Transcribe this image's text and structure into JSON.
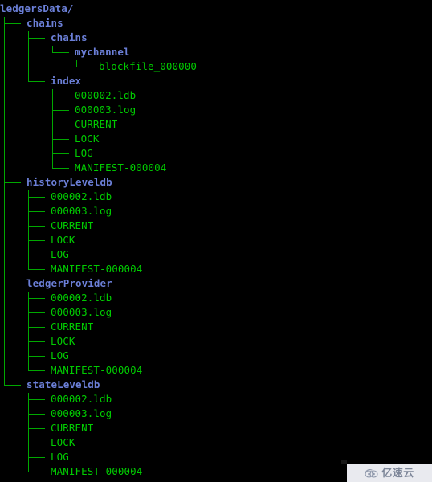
{
  "terminal": {
    "background_color": "#000000",
    "dir_color": "#6b7fd7",
    "file_color": "#00cc00",
    "line_color": "#00a800",
    "root": "ledgersData/"
  },
  "tree": {
    "rows": [
      {
        "text": "ledgersData/",
        "kind": "dir",
        "depth": 0
      },
      {
        "text": "chains",
        "kind": "dir",
        "depth": 1
      },
      {
        "text": "chains",
        "kind": "dir",
        "depth": 2
      },
      {
        "text": "mychannel",
        "kind": "dir",
        "depth": 3
      },
      {
        "text": "blockfile_000000",
        "kind": "file",
        "depth": 4
      },
      {
        "text": "index",
        "kind": "dir",
        "depth": 2
      },
      {
        "text": "000002.ldb",
        "kind": "file",
        "depth": 3
      },
      {
        "text": "000003.log",
        "kind": "file",
        "depth": 3
      },
      {
        "text": "CURRENT",
        "kind": "file",
        "depth": 3
      },
      {
        "text": "LOCK",
        "kind": "file",
        "depth": 3
      },
      {
        "text": "LOG",
        "kind": "file",
        "depth": 3
      },
      {
        "text": "MANIFEST-000004",
        "kind": "file",
        "depth": 3
      },
      {
        "text": "historyLeveldb",
        "kind": "dir",
        "depth": 1
      },
      {
        "text": "000002.ldb",
        "kind": "file",
        "depth": 2
      },
      {
        "text": "000003.log",
        "kind": "file",
        "depth": 2
      },
      {
        "text": "CURRENT",
        "kind": "file",
        "depth": 2
      },
      {
        "text": "LOCK",
        "kind": "file",
        "depth": 2
      },
      {
        "text": "LOG",
        "kind": "file",
        "depth": 2
      },
      {
        "text": "MANIFEST-000004",
        "kind": "file",
        "depth": 2
      },
      {
        "text": "ledgerProvider",
        "kind": "dir",
        "depth": 1
      },
      {
        "text": "000002.ldb",
        "kind": "file",
        "depth": 2
      },
      {
        "text": "000003.log",
        "kind": "file",
        "depth": 2
      },
      {
        "text": "CURRENT",
        "kind": "file",
        "depth": 2
      },
      {
        "text": "LOCK",
        "kind": "file",
        "depth": 2
      },
      {
        "text": "LOG",
        "kind": "file",
        "depth": 2
      },
      {
        "text": "MANIFEST-000004",
        "kind": "file",
        "depth": 2
      },
      {
        "text": "stateLeveldb",
        "kind": "dir",
        "depth": 1
      },
      {
        "text": "000002.ldb",
        "kind": "file",
        "depth": 2
      },
      {
        "text": "000003.log",
        "kind": "file",
        "depth": 2
      },
      {
        "text": "CURRENT",
        "kind": "file",
        "depth": 2
      },
      {
        "text": "LOCK",
        "kind": "file",
        "depth": 2
      },
      {
        "text": "LOG",
        "kind": "file",
        "depth": 2
      },
      {
        "text": "MANIFEST-000004",
        "kind": "file",
        "depth": 2
      }
    ]
  },
  "watermark": {
    "text": "亿速云",
    "icon": "cloud-icon",
    "background_color": "#e9eaef",
    "text_color": "#7c8598"
  }
}
